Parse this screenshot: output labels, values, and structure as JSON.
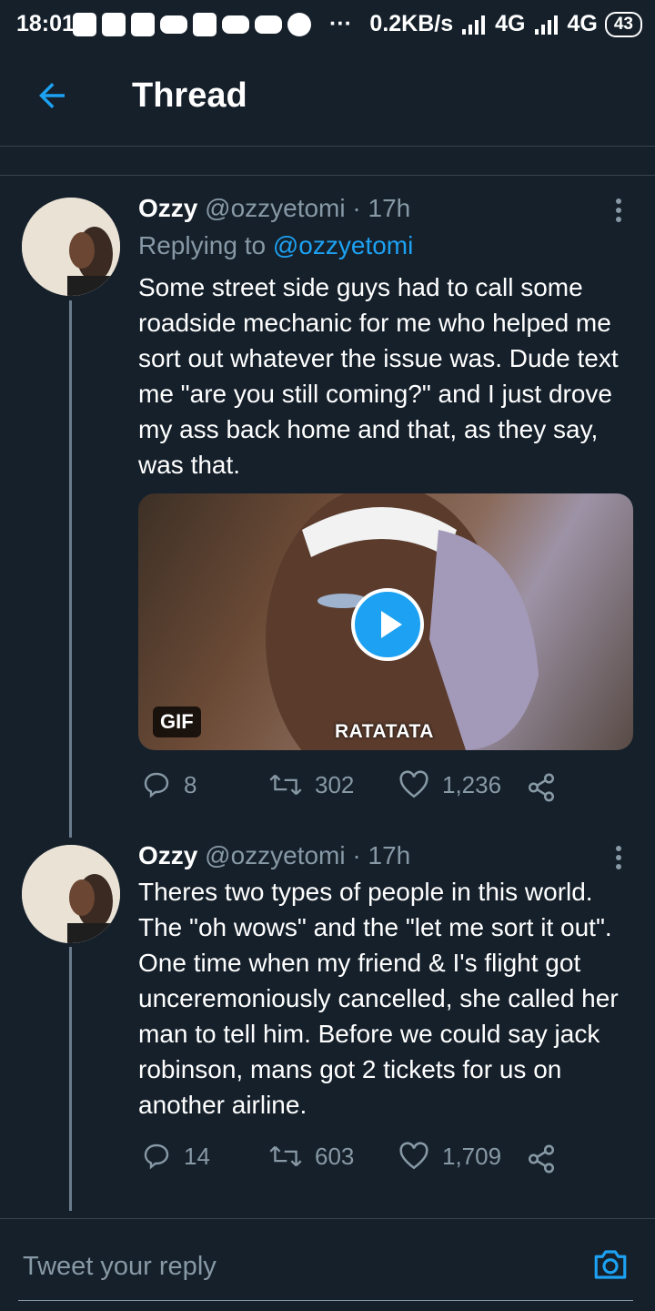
{
  "status_bar": {
    "time": "18:01",
    "speed": "0.2KB/s",
    "net1": "4G",
    "net2": "4G",
    "battery": "43"
  },
  "header": {
    "title": "Thread"
  },
  "tweets": [
    {
      "name": "Ozzy",
      "handle": "@ozzyetomi",
      "time": "· 17h",
      "reply_prefix": "Replying to",
      "reply_handle": "@ozzyetomi",
      "text": "Some street side guys had to call some roadside mechanic for me who helped me sort out whatever the issue was. Dude text me \"are you still coming?\" and I just drove my ass back home and that, as they say, was that.",
      "media": {
        "badge": "GIF",
        "caption": "RATATATA"
      },
      "replies": "8",
      "retweets": "302",
      "likes": "1,236"
    },
    {
      "name": "Ozzy",
      "handle": "@ozzyetomi",
      "time": "· 17h",
      "text": "Theres two types of people in this world. The \"oh wows\" and the \"let me sort it out\". One time when my friend & I's flight got unceremoniously cancelled, she called her man to tell him. Before we could say jack robinson, mans got 2 tickets for us on another airline.",
      "replies": "14",
      "retweets": "603",
      "likes": "1,709"
    }
  ],
  "reply_bar": {
    "placeholder": "Tweet your reply"
  },
  "colors": {
    "background": "#15202b",
    "accent": "#1da1f2",
    "muted": "#8899a6"
  }
}
